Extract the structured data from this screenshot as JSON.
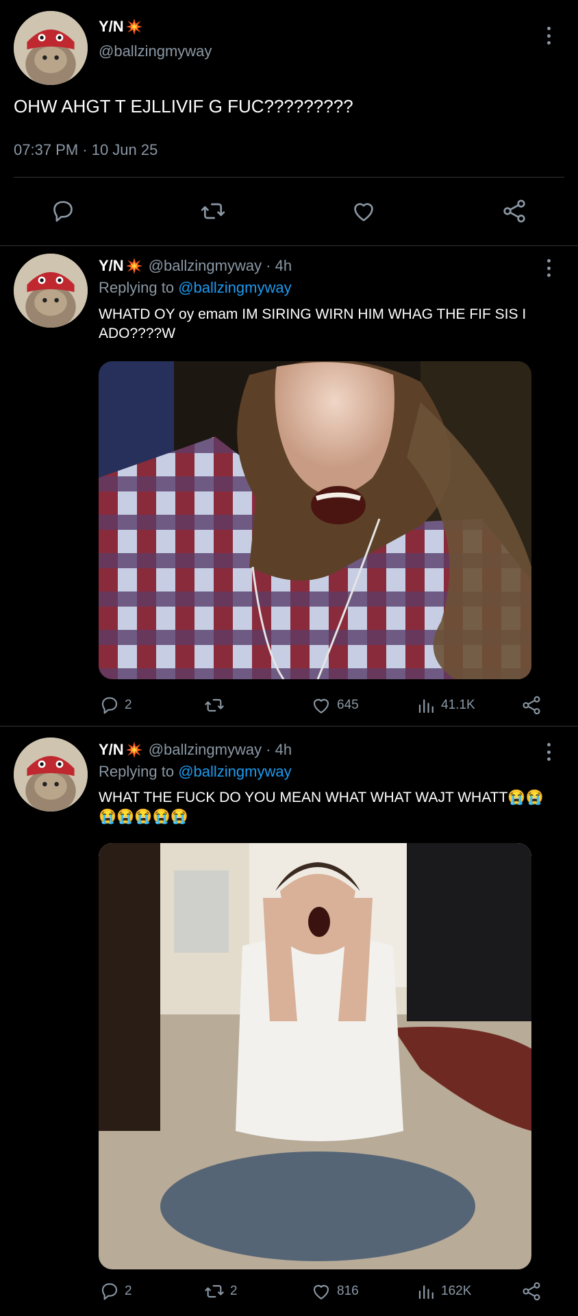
{
  "main_tweet": {
    "display_name": "Y/N",
    "handle": "@ballzingmyway",
    "text": "OHW AHGT T EJLLIVIF G FUC?????????",
    "timestamp": "07:37 PM · 10 Jun 25",
    "icons": [
      "reply-icon",
      "retweet-icon",
      "like-icon",
      "share-icon"
    ]
  },
  "replies": [
    {
      "display_name": "Y/N",
      "handle_time": "@ballzingmyway · 4h",
      "replying_prefix": "Replying to ",
      "replying_handle": "@ballzingmyway",
      "text": "WHATD OY oy emam IM SIRING WIRN HIM WHAG THE FIF SIS I ADO????W",
      "reply_count": "2",
      "retweet_count": "",
      "like_count": "645",
      "view_count": "41.1K"
    },
    {
      "display_name": "Y/N",
      "handle_time": "@ballzingmyway · 4h",
      "replying_prefix": "Replying to ",
      "replying_handle": "@ballzingmyway",
      "text": "WHAT THE FUCK DO YOU MEAN WHAT WHAT WAJT WHATT😭😭😭😭😭😭😭",
      "reply_count": "2",
      "retweet_count": "2",
      "like_count": "816",
      "view_count": "162K"
    }
  ],
  "colors": {
    "background": "#000000",
    "text_secondary": "#8b98a5",
    "link": "#1d9bf0",
    "divider": "#2f3336",
    "burst": "#ff5a1f"
  }
}
